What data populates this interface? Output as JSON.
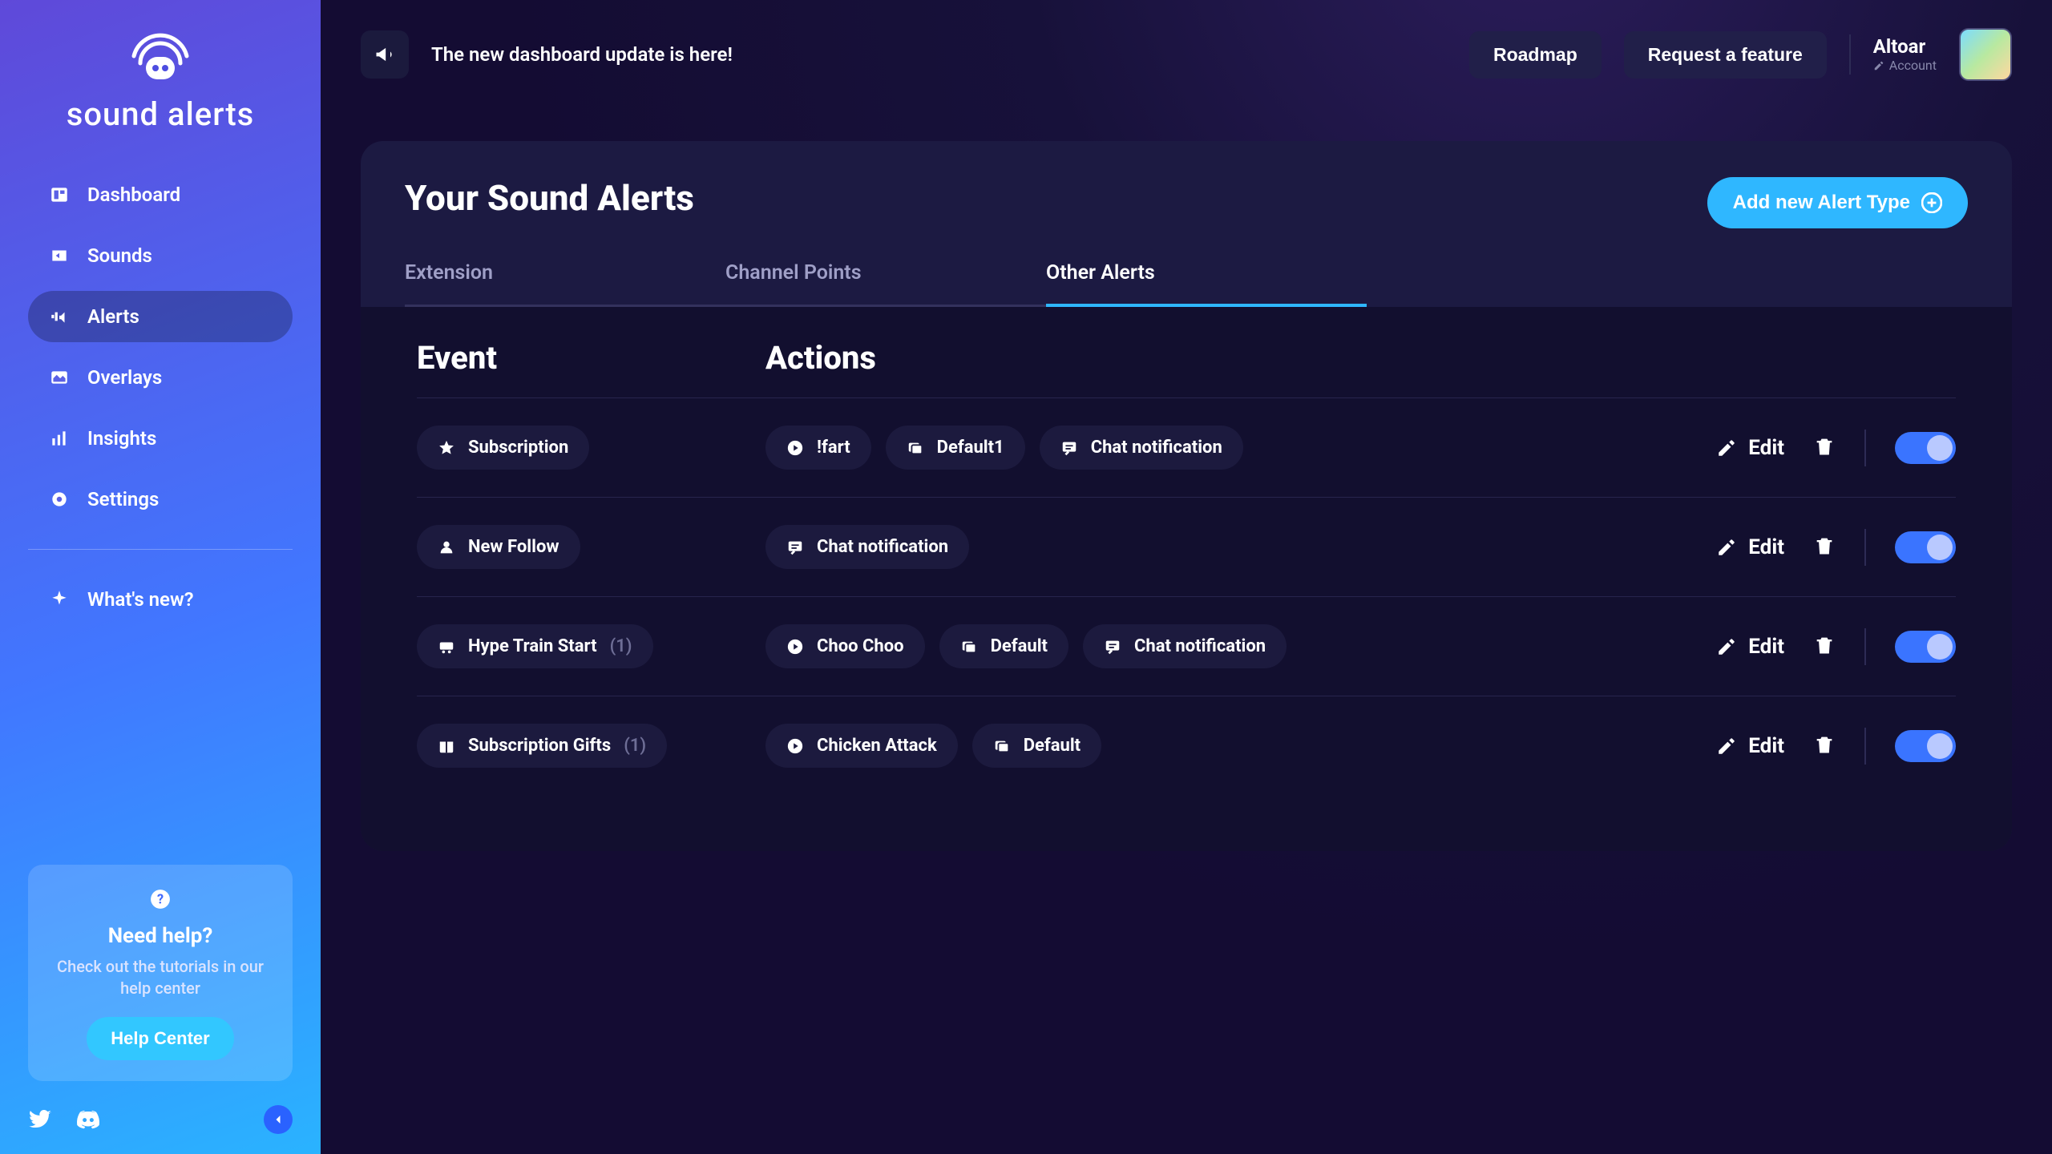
{
  "brand": "sound alerts",
  "sidebar": {
    "items": [
      {
        "label": "Dashboard"
      },
      {
        "label": "Sounds"
      },
      {
        "label": "Alerts"
      },
      {
        "label": "Overlays"
      },
      {
        "label": "Insights"
      },
      {
        "label": "Settings"
      }
    ],
    "whats_new": "What's new?",
    "help_title": "Need help?",
    "help_text": "Check out the tutorials in our help center",
    "help_button": "Help Center"
  },
  "topbar": {
    "announcement": "The new dashboard update is here!",
    "roadmap": "Roadmap",
    "request": "Request a feature",
    "username": "Altoar",
    "account": "Account"
  },
  "panel": {
    "title": "Your Sound Alerts",
    "add_button": "Add new Alert Type",
    "tabs": [
      {
        "label": "Extension"
      },
      {
        "label": "Channel Points"
      },
      {
        "label": "Other Alerts"
      }
    ],
    "columns": {
      "event": "Event",
      "actions": "Actions"
    },
    "edit": "Edit",
    "rows": [
      {
        "event": "Subscription",
        "count": "",
        "actions": [
          {
            "icon": "play",
            "label": "!fart"
          },
          {
            "icon": "image",
            "label": "Default1"
          },
          {
            "icon": "chat",
            "label": "Chat notification"
          }
        ]
      },
      {
        "event": "New Follow",
        "count": "",
        "actions": [
          {
            "icon": "chat",
            "label": "Chat notification"
          }
        ]
      },
      {
        "event": "Hype Train Start",
        "count": "(1)",
        "actions": [
          {
            "icon": "play",
            "label": "Choo Choo"
          },
          {
            "icon": "image",
            "label": "Default"
          },
          {
            "icon": "chat",
            "label": "Chat notification"
          }
        ]
      },
      {
        "event": "Subscription Gifts",
        "count": "(1)",
        "actions": [
          {
            "icon": "play",
            "label": "Chicken Attack"
          },
          {
            "icon": "image",
            "label": "Default"
          }
        ]
      }
    ]
  }
}
